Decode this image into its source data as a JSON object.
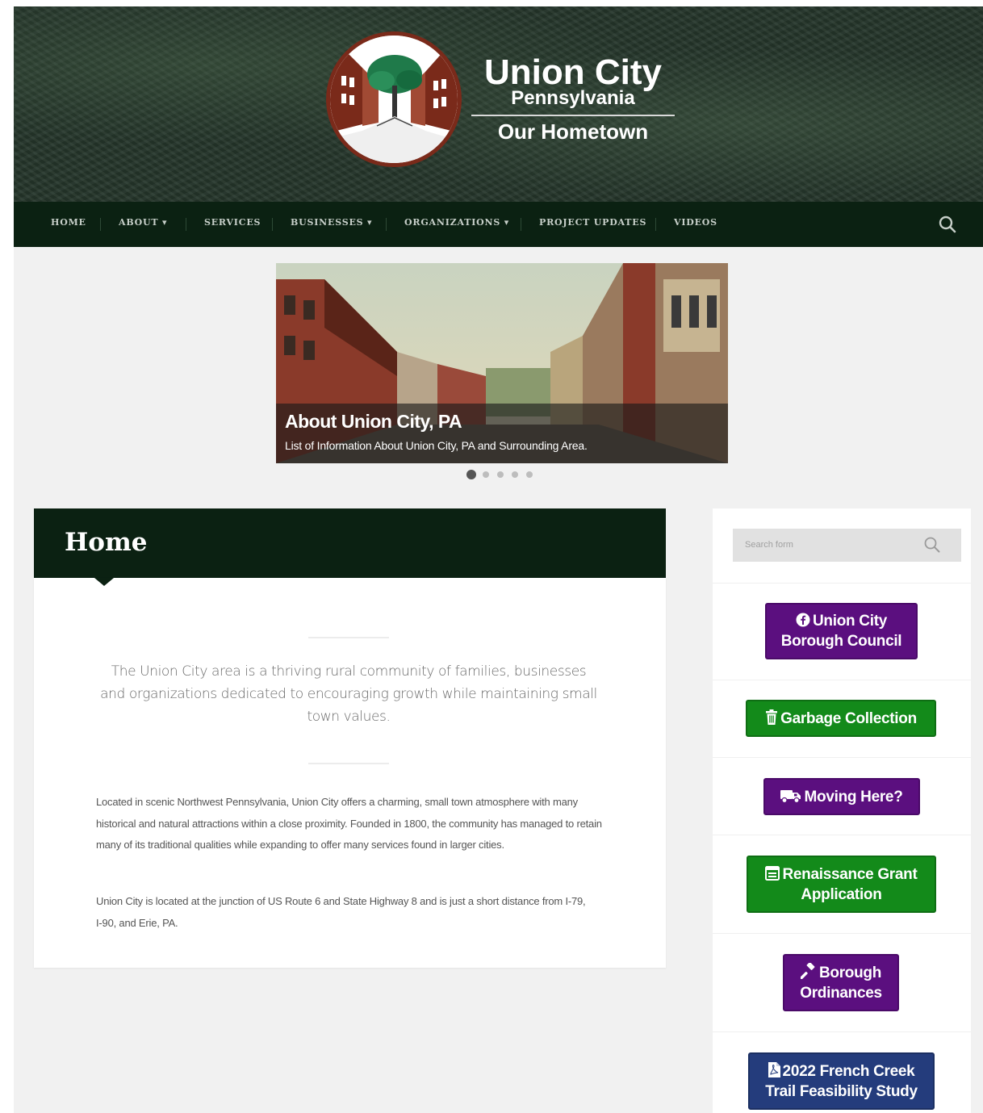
{
  "header": {
    "title": "Union City",
    "subtitle": "Pennsylvania",
    "tagline": "Our Hometown"
  },
  "nav": {
    "items": [
      {
        "label": "HOME"
      },
      {
        "label": "ABOUT ▾"
      },
      {
        "label": "SERVICES"
      },
      {
        "label": "BUSINESSES ▾"
      },
      {
        "label": "ORGANIZATIONS ▾"
      },
      {
        "label": "PROJECT UPDATES"
      },
      {
        "label": "VIDEOS"
      }
    ]
  },
  "slider": {
    "title": "About Union City, PA",
    "text": "List of Information About Union City, PA and Surrounding Area.",
    "slide_count": 5,
    "active_slide": 1
  },
  "main": {
    "page_title": "Home",
    "lead": "The Union City area is a thriving rural community of families, businesses and organizations dedicated to encouraging growth while maintaining small town values.",
    "paragraphs": [
      "Located in scenic Northwest Pennsylvania, Union City offers a charming, small town atmosphere with many historical and natural attractions within a close proximity. Founded in 1800, the community has managed to retain many of its traditional qualities while expanding to offer many services found in larger cities.",
      "Union City is located at the junction of US Route 6 and State Highway 8 and is just a short distance from I-79, I-90, and Erie, PA."
    ]
  },
  "sidebar": {
    "search_placeholder": "Search form",
    "buttons": [
      {
        "line1": "Union City",
        "line2": "Borough Council",
        "icon": "facebook-icon",
        "color": "#5b0f7f"
      },
      {
        "line1": "Garbage Collection",
        "icon": "trash-icon",
        "color": "#138a1a"
      },
      {
        "line1": "Moving Here?",
        "icon": "truck-icon",
        "color": "#5b0f7f"
      },
      {
        "line1": "Renaissance Grant",
        "line2": "Application",
        "icon": "form-icon",
        "color": "#138a1a"
      },
      {
        "line1": "Borough",
        "line2": "Ordinances",
        "icon": "gavel-icon",
        "color": "#5b0f7f"
      },
      {
        "line1": "2022 French Creek",
        "line2": "Trail Feasibility Study",
        "icon": "pdf-icon",
        "color": "#243c7c"
      }
    ]
  },
  "colors": {
    "nav_bg": "#0b2112",
    "purple": "#5b0f7f",
    "green": "#138a1a",
    "navy": "#243c7c"
  }
}
